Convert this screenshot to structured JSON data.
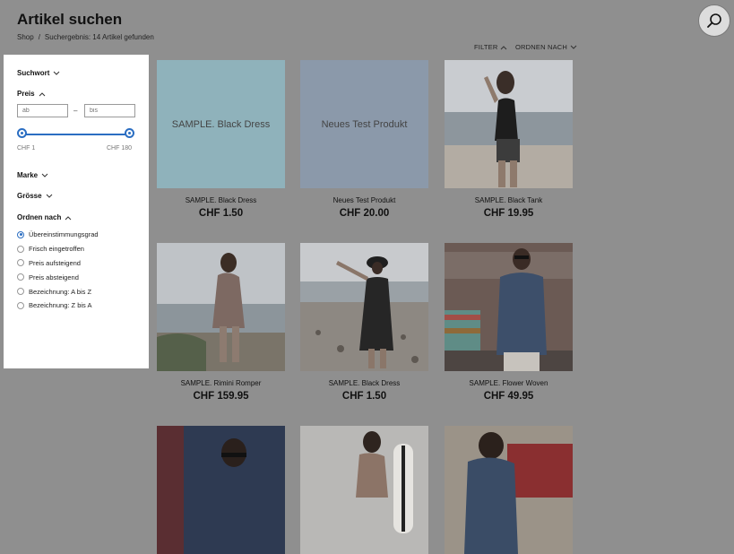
{
  "header": {
    "title": "Artikel suchen",
    "breadcrumb": {
      "home": "Shop",
      "separator": "/",
      "current": "Suchergebnis: 14 Artikel gefunden"
    }
  },
  "toolbar": {
    "filter_label": "FILTER",
    "sort_label": "ORDNEN NACH"
  },
  "sidebar": {
    "keyword_label": "Suchwort",
    "price_label": "Preis",
    "price_from_placeholder": "ab",
    "price_to_placeholder": "bis",
    "price_dash": "–",
    "range_min": "CHF 1",
    "range_max": "CHF 180",
    "brand_label": "Marke",
    "size_label": "Grösse",
    "sort_label": "Ordnen nach",
    "sort_options": [
      {
        "label": "Übereinstimmungsgrad",
        "selected": true
      },
      {
        "label": "Frisch eingetroffen",
        "selected": false
      },
      {
        "label": "Preis aufsteigend",
        "selected": false
      },
      {
        "label": "Preis absteigend",
        "selected": false
      },
      {
        "label": "Bezeichnung: A bis Z",
        "selected": false
      },
      {
        "label": "Bezeichnung: Z bis A",
        "selected": false
      }
    ]
  },
  "products": [
    {
      "name": "SAMPLE. Black Dress",
      "price": "CHF 1.50",
      "placeholder": "SAMPLE. Black Dress",
      "placeholder_color": "#8fb2bb"
    },
    {
      "name": "Neues Test Produkt",
      "price": "CHF 20.00",
      "placeholder": "Neues Test Produkt",
      "placeholder_color": "#8b99aa"
    },
    {
      "name": "SAMPLE. Black Tank",
      "price": "CHF 19.95",
      "image": "beach-woman-black-tank"
    },
    {
      "name": "SAMPLE. Rimini Romper",
      "price": "CHF 159.95",
      "image": "beach-woman-romper"
    },
    {
      "name": "SAMPLE. Black Dress",
      "price": "CHF 1.50",
      "image": "beach-woman-black-dress-hat"
    },
    {
      "name": "SAMPLE. Flower Woven",
      "price": "CHF 49.95",
      "image": "man-flower-shirt-van"
    },
    {
      "image": "woman-sunglasses-car"
    },
    {
      "image": "woman-surfboard"
    },
    {
      "image": "man-red-truck"
    }
  ],
  "colors": {
    "accent": "#2b6ec2",
    "overlay": "#8f8f8f"
  }
}
